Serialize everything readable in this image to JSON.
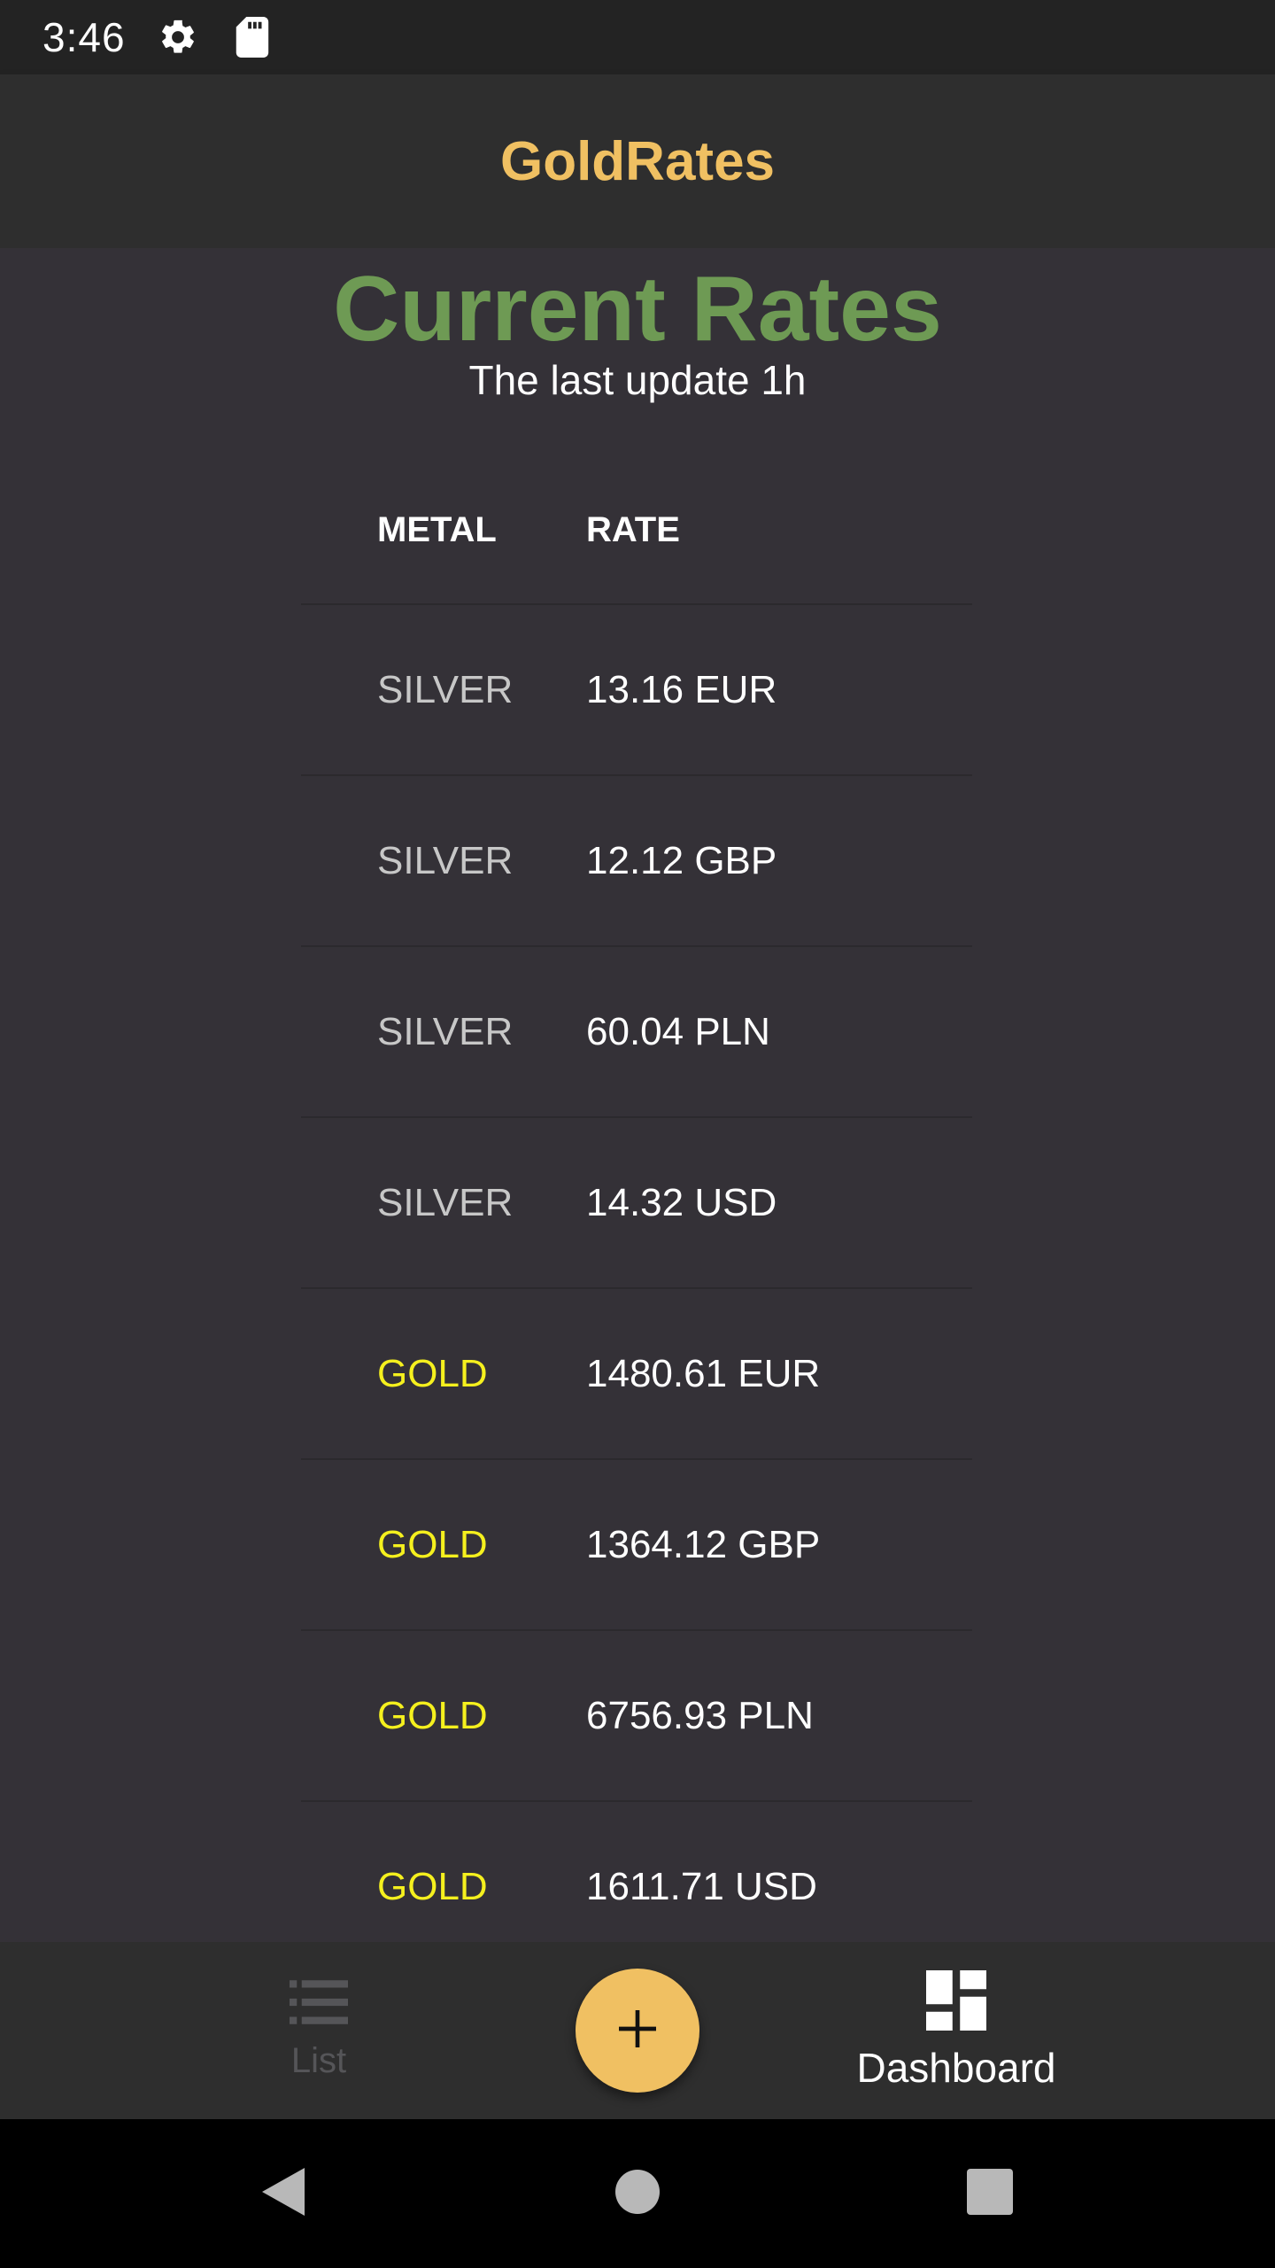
{
  "status_bar": {
    "time": "3:46",
    "icons": [
      "gear-icon",
      "sd-card-icon"
    ]
  },
  "app_bar": {
    "title": "GoldRates"
  },
  "main": {
    "title": "Current Rates",
    "subtitle": "The last update 1h",
    "table": {
      "headers": {
        "metal": "METAL",
        "rate": "RATE"
      },
      "rows": [
        {
          "metal": "SILVER",
          "rate": "13.16 EUR"
        },
        {
          "metal": "SILVER",
          "rate": "12.12 GBP"
        },
        {
          "metal": "SILVER",
          "rate": "60.04 PLN"
        },
        {
          "metal": "SILVER",
          "rate": "14.32 USD"
        },
        {
          "metal": "GOLD",
          "rate": "1480.61 EUR"
        },
        {
          "metal": "GOLD",
          "rate": "1364.12 GBP"
        },
        {
          "metal": "GOLD",
          "rate": "6756.93 PLN"
        },
        {
          "metal": "GOLD",
          "rate": "1611.71 USD"
        }
      ]
    }
  },
  "bottom_nav": {
    "list_label": "List",
    "dashboard_label": "Dashboard",
    "fab_icon": "plus-icon",
    "active": "Dashboard"
  },
  "colors": {
    "accent": "#f0c062",
    "title_green": "#6e9a54",
    "silver": "#c7c7c7",
    "gold": "#f5f01e",
    "background": "#343137",
    "bar": "#2e2e2e"
  }
}
